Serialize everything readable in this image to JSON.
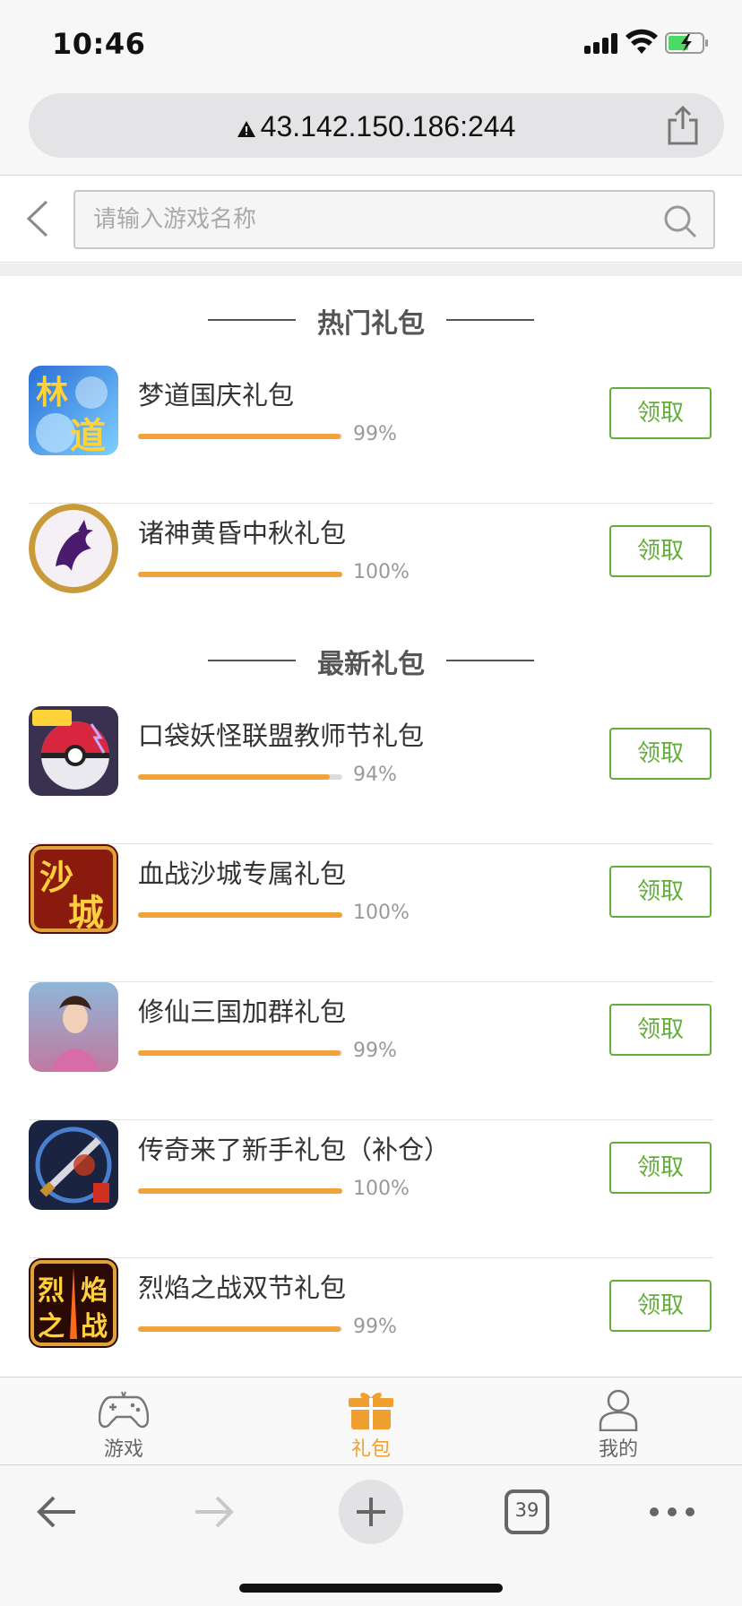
{
  "status_bar": {
    "time": "10:46"
  },
  "url_bar": {
    "url": "43.142.150.186:244"
  },
  "search": {
    "placeholder": "请输入游戏名称"
  },
  "sections": {
    "hot_title": "热门礼包",
    "new_title": "最新礼包"
  },
  "hot_items": [
    {
      "name": "梦道国庆礼包",
      "percent_text": "99%",
      "progress": 0.99,
      "button": "领取",
      "icon": "game-icon-mengdao"
    },
    {
      "name": "诸神黄昏中秋礼包",
      "percent_text": "100%",
      "progress": 1.0,
      "button": "领取",
      "icon": "game-icon-dragon"
    }
  ],
  "new_items": [
    {
      "name": "口袋妖怪联盟教师节礼包",
      "percent_text": "94%",
      "progress": 0.94,
      "button": "领取",
      "icon": "game-icon-pokeball"
    },
    {
      "name": "血战沙城专属礼包",
      "percent_text": "100%",
      "progress": 1.0,
      "button": "领取",
      "icon": "game-icon-shacheng"
    },
    {
      "name": "修仙三国加群礼包",
      "percent_text": "99%",
      "progress": 0.99,
      "button": "领取",
      "icon": "game-icon-xiuxian"
    },
    {
      "name": "传奇来了新手礼包（补仓）",
      "percent_text": "100%",
      "progress": 1.0,
      "button": "领取",
      "icon": "game-icon-chuanqi"
    },
    {
      "name": "烈焰之战双节礼包",
      "percent_text": "99%",
      "progress": 0.99,
      "button": "领取",
      "icon": "game-icon-lieyan"
    }
  ],
  "tab_bar": {
    "tabs": [
      {
        "label": "游戏",
        "icon": "gamepad-icon",
        "active": false
      },
      {
        "label": "礼包",
        "icon": "gift-icon",
        "active": true
      },
      {
        "label": "我的",
        "icon": "user-icon",
        "active": false
      }
    ]
  },
  "browser_toolbar": {
    "tab_count": "39"
  },
  "colors": {
    "accent_green": "#64ad3b",
    "progress_orange": "#f1a33a",
    "active_tab": "#f0a030"
  }
}
